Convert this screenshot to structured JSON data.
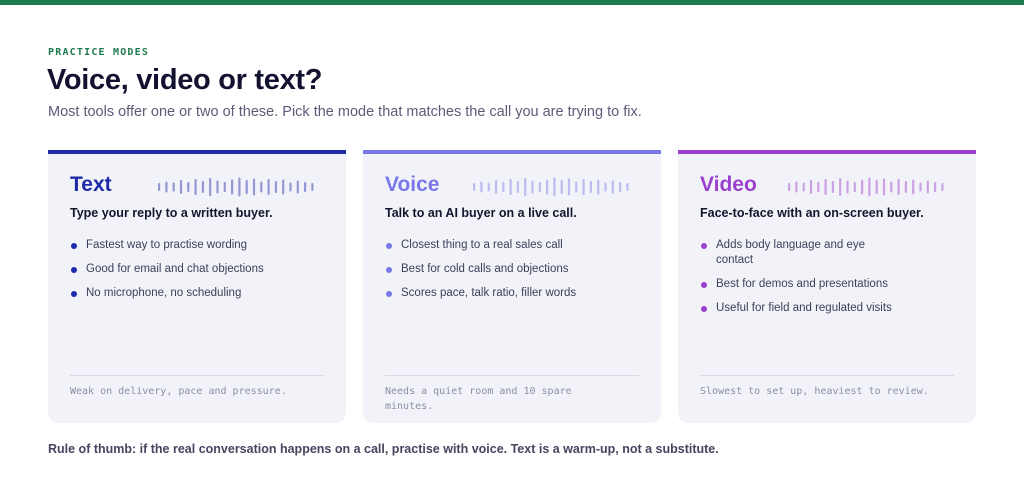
{
  "header": {
    "eyebrow": "PRACTICE MODES",
    "title": "Voice, video or text?",
    "subtitle": "Most tools offer one or two of these. Pick the mode that matches the call you are trying to fix."
  },
  "cards": [
    {
      "name": "Text",
      "accent": "#1f2aa8",
      "tagline": "Type your reply to a written buyer.",
      "bullets": [
        "Fastest way to practise wording",
        "Good for email and chat objections",
        "No microphone, no scheduling"
      ],
      "weakness": "Weak on delivery, pace and pressure."
    },
    {
      "name": "Voice",
      "accent": "#7a78e8",
      "tagline": "Talk to an AI buyer on a live call.",
      "bullets": [
        "Closest thing to a real sales call",
        "Best for cold calls and objections",
        "Scores pace, talk ratio, filler words"
      ],
      "weakness": "Needs a quiet room and 10 spare minutes."
    },
    {
      "name": "Video",
      "accent": "#9b3fcf",
      "tagline": "Face-to-face with an on-screen buyer.",
      "bullets": [
        "Adds body language and eye contact",
        "Best for demos and presentations",
        "Useful for field and regulated visits"
      ],
      "weakness": "Slowest to set up, heaviest to review."
    }
  ],
  "footer": {
    "rule": "Rule of thumb: if the real conversation happens on a call, practise with voice. Text is a warm-up, not a substitute."
  }
}
